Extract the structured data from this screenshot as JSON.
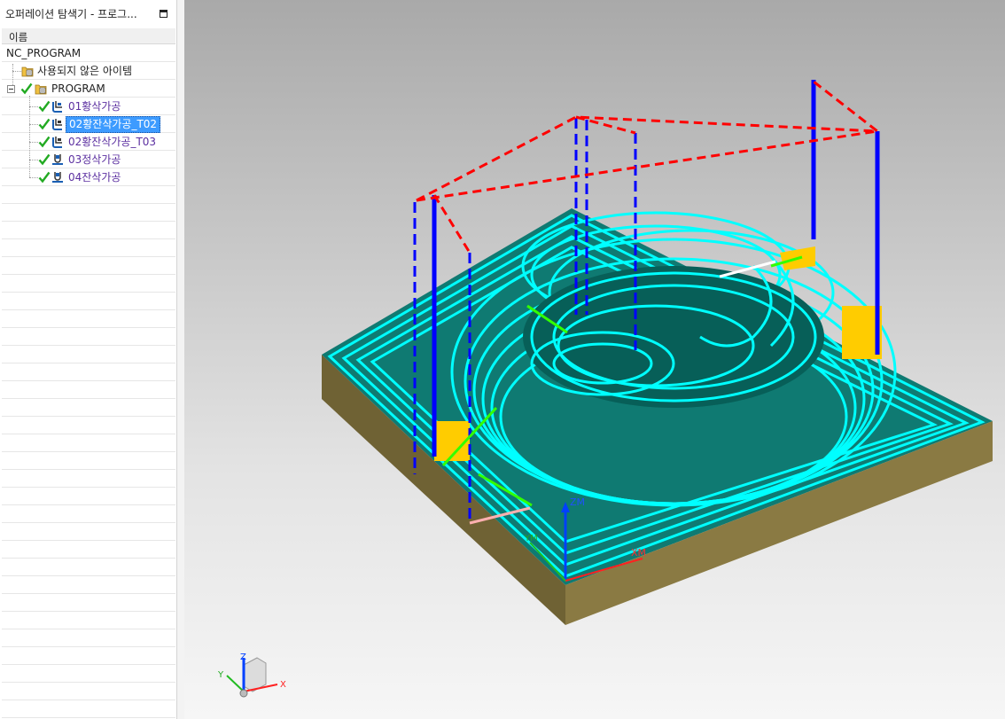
{
  "panel": {
    "title": "오퍼레이션 탐색기 - 프로그...",
    "column_header": "이름"
  },
  "tree": {
    "root": "NC_PROGRAM",
    "unused": "사용되지 않은 아이템",
    "program": "PROGRAM",
    "operations": [
      {
        "label": "01황삭가공",
        "selected": false
      },
      {
        "label": "02황잔삭가공_T02",
        "selected": true
      },
      {
        "label": "02황잔삭가공_T03",
        "selected": false
      },
      {
        "label": "03정삭가공",
        "selected": false
      },
      {
        "label": "04잔삭가공",
        "selected": false
      }
    ]
  },
  "viewport": {
    "wcs_z": "ZM",
    "wcs_x": "XM",
    "wcs_y": "YM",
    "triad_z": "Z",
    "triad_x": "X",
    "triad_y": "Y"
  },
  "colors": {
    "selection": "#3d9bff",
    "toolpath_cut": "#00ffff",
    "toolpath_rapid": "#ff0000",
    "toolpath_plunge": "#0000ff",
    "stock_top": "#0f7a72",
    "stock_side": "#7a6b3a",
    "check_green": "#22aa22"
  }
}
